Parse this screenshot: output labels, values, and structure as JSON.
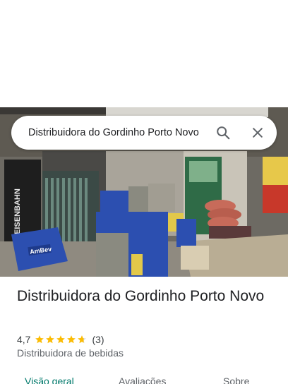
{
  "search": {
    "query": "Distribuidora do Gordinho Porto Novo"
  },
  "place": {
    "name": "Distribuidora do Gordinho Porto Novo",
    "rating": "4,7",
    "rating_value": 4.7,
    "max_rating": 5,
    "review_count": "(3)",
    "category": "Distribuidora de bebidas"
  },
  "tabs": [
    {
      "label": "Visão geral",
      "active": true
    },
    {
      "label": "Avaliações",
      "active": false
    },
    {
      "label": "Sobre",
      "active": false
    }
  ],
  "photo": {
    "crate_label": "AmBev",
    "banner_text": "EISENBAHN"
  },
  "colors": {
    "star": "#fbbc04",
    "active_tab": "#00796b",
    "crate_blue": "#2c4fb0",
    "crate_gray": "#8a8a80"
  },
  "icons": {
    "search": "search-icon",
    "close": "close-icon",
    "star": "star-icon"
  }
}
